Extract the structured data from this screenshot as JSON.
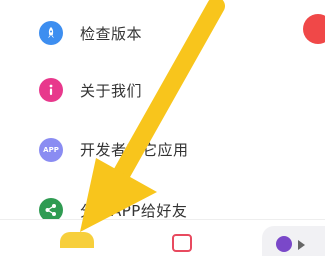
{
  "menu": {
    "items": [
      {
        "id": "check",
        "label": "检查版本",
        "icon": "rocket-icon",
        "color": "#3d8ef0"
      },
      {
        "id": "about",
        "label": "关于我们",
        "icon": "info-icon",
        "color": "#e8388c"
      },
      {
        "id": "apps",
        "label": "开发者其它应用",
        "icon": "app-icon",
        "icon_text": "APP",
        "color": "#8a8cf2"
      },
      {
        "id": "share",
        "label": "分享APP给好友",
        "icon": "share-icon",
        "color": "#2f9b52"
      }
    ]
  },
  "overlay": {
    "icon": "pointer-arrow-icon",
    "color": "#f8c51c"
  },
  "bottom_bar": {
    "tabs": [
      "home-tab-icon",
      "notes-tab-icon",
      "profile-tab-icon"
    ]
  }
}
